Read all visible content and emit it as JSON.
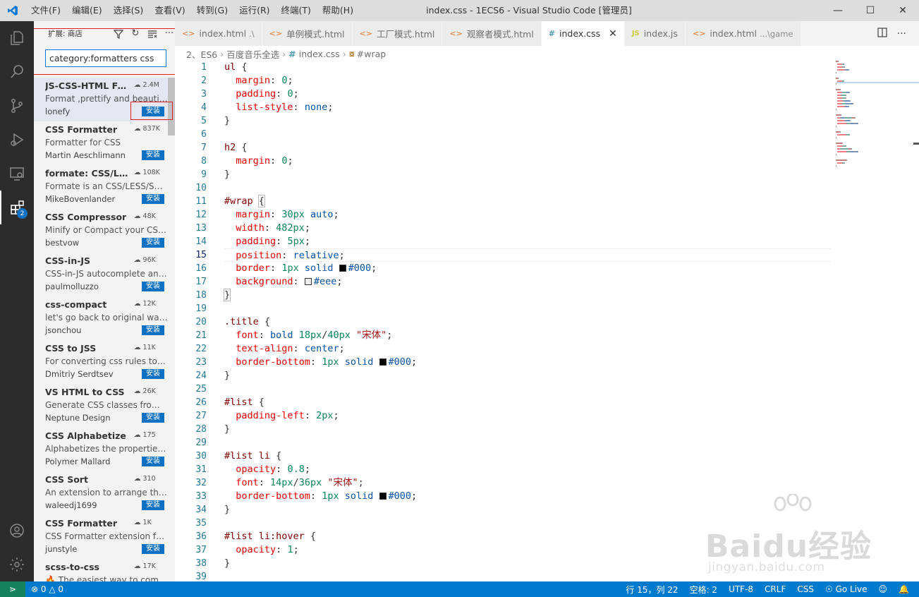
{
  "window": {
    "title": "index.css - 1ECS6 - Visual Studio Code [管理员]",
    "menu": [
      "文件(F)",
      "编辑(E)",
      "选择(S)",
      "查看(V)",
      "转到(G)",
      "运行(R)",
      "终端(T)",
      "帮助(H)"
    ]
  },
  "activity_bar": {
    "extensions_badge": "2"
  },
  "sidebar": {
    "title": "扩展: 商店",
    "search_value": "category:formatters css",
    "install_label": "安装",
    "extensions": [
      {
        "name": "JS-CSS-HTML Fo...",
        "downloads": "2.4M",
        "description": "Format ,prettify and beautify...",
        "author": "lonefy"
      },
      {
        "name": "CSS Formatter",
        "downloads": "837K",
        "description": "Formatter for CSS",
        "author": "Martin Aeschlimann"
      },
      {
        "name": "formate: CSS/LES...",
        "downloads": "108K",
        "description": "Formate is an CSS/LESS/SCS...",
        "author": "MikeBovenlander"
      },
      {
        "name": "CSS Compressor",
        "downloads": "48K",
        "description": "Minify or Compact your CSS...",
        "author": "bestvow"
      },
      {
        "name": "CSS-in-JS",
        "downloads": "96K",
        "description": "CSS-in-JS autocomplete and...",
        "author": "paulmolluzzo"
      },
      {
        "name": "css-compact",
        "downloads": "12K",
        "description": "let's go back to original way...",
        "author": "jsonchou"
      },
      {
        "name": "CSS to JSS",
        "downloads": "11K",
        "description": "For converting css rules to js...",
        "author": "Dmitriy Serdtsev"
      },
      {
        "name": "VS HTML to CSS",
        "downloads": "26K",
        "description": "Generate CSS classes from ...",
        "author": "Neptune Design"
      },
      {
        "name": "CSS Alphabetize",
        "downloads": "175",
        "description": "Alphabetizes the properties ...",
        "author": "Polymer Mallard"
      },
      {
        "name": "CSS Sort",
        "downloads": "310",
        "description": "An extension to arrange the ...",
        "author": "waleedj1699"
      },
      {
        "name": "CSS Formatter",
        "downloads": "1K",
        "description": "CSS Formatter extension for...",
        "author": "junstyle"
      },
      {
        "name": "scss-to-css",
        "downloads": "17K",
        "description": "🔥 The easiest way to compi...",
        "author": ""
      }
    ]
  },
  "tabs": [
    {
      "label": "index.html",
      "sub": ".\\",
      "icon": "<>",
      "kind": "html"
    },
    {
      "label": "单例模式.html",
      "sub": "",
      "icon": "<>",
      "kind": "html"
    },
    {
      "label": "工厂模式.html",
      "sub": "",
      "icon": "<>",
      "kind": "html"
    },
    {
      "label": "观察者模式.html",
      "sub": "",
      "icon": "<>",
      "kind": "html"
    },
    {
      "label": "index.css",
      "sub": "",
      "icon": "#",
      "kind": "css",
      "active": true
    },
    {
      "label": "index.js",
      "sub": "",
      "icon": "JS",
      "kind": "js"
    },
    {
      "label": "index.html",
      "sub": "...\\game",
      "icon": "<>",
      "kind": "html"
    }
  ],
  "breadcrumb": {
    "folder1": "2、ES6",
    "folder2": "百度音乐全选",
    "file": "index.css",
    "symbol": "#wrap"
  },
  "editor": {
    "current_line": 15,
    "lines": [
      [
        [
          "sel",
          "ul "
        ],
        [
          "pun",
          "{"
        ]
      ],
      [
        [
          "",
          "  "
        ],
        [
          "prop",
          "margin"
        ],
        [
          "pun",
          ": "
        ],
        [
          "num",
          "0"
        ],
        [
          "pun",
          ";"
        ]
      ],
      [
        [
          "",
          "  "
        ],
        [
          "prop",
          "padding"
        ],
        [
          "pun",
          ": "
        ],
        [
          "num",
          "0"
        ],
        [
          "pun",
          ";"
        ]
      ],
      [
        [
          "",
          "  "
        ],
        [
          "prop",
          "list-style"
        ],
        [
          "pun",
          ": "
        ],
        [
          "val",
          "none"
        ],
        [
          "pun",
          ";"
        ]
      ],
      [
        [
          "pun",
          "}"
        ]
      ],
      [],
      [
        [
          "sel",
          "h2 "
        ],
        [
          "pun",
          "{"
        ]
      ],
      [
        [
          "",
          "  "
        ],
        [
          "prop",
          "margin"
        ],
        [
          "pun",
          ": "
        ],
        [
          "num",
          "0"
        ],
        [
          "pun",
          ";"
        ]
      ],
      [
        [
          "pun",
          "}"
        ]
      ],
      [],
      [
        [
          "sel",
          "#wrap "
        ],
        [
          "pun",
          "{"
        ]
      ],
      [
        [
          "",
          "  "
        ],
        [
          "prop",
          "margin"
        ],
        [
          "pun",
          ": "
        ],
        [
          "num",
          "30px"
        ],
        [
          "pun",
          " "
        ],
        [
          "val",
          "auto"
        ],
        [
          "pun",
          ";"
        ]
      ],
      [
        [
          "",
          "  "
        ],
        [
          "prop",
          "width"
        ],
        [
          "pun",
          ": "
        ],
        [
          "num",
          "482px"
        ],
        [
          "pun",
          ";"
        ]
      ],
      [
        [
          "",
          "  "
        ],
        [
          "prop",
          "padding"
        ],
        [
          "pun",
          ": "
        ],
        [
          "num",
          "5px"
        ],
        [
          "pun",
          ";"
        ]
      ],
      [
        [
          "",
          "  "
        ],
        [
          "prop",
          "position"
        ],
        [
          "pun",
          ": "
        ],
        [
          "val",
          "relative"
        ],
        [
          "pun",
          ";"
        ]
      ],
      [
        [
          "",
          "  "
        ],
        [
          "prop",
          "border"
        ],
        [
          "pun",
          ": "
        ],
        [
          "num",
          "1px"
        ],
        [
          "pun",
          " "
        ],
        [
          "val",
          "solid"
        ],
        [
          "pun",
          " "
        ],
        [
          "swatch",
          "#000"
        ],
        [
          "val",
          "#000"
        ],
        [
          "pun",
          ";"
        ]
      ],
      [
        [
          "",
          "  "
        ],
        [
          "prop",
          "background"
        ],
        [
          "pun",
          ": "
        ],
        [
          "swatch",
          "#eee"
        ],
        [
          "val",
          "#eee"
        ],
        [
          "pun",
          ";"
        ]
      ],
      [
        [
          "pun",
          "}"
        ]
      ],
      [],
      [
        [
          "sel",
          ".title "
        ],
        [
          "pun",
          "{"
        ]
      ],
      [
        [
          "",
          "  "
        ],
        [
          "prop",
          "font"
        ],
        [
          "pun",
          ": "
        ],
        [
          "val",
          "bold"
        ],
        [
          "pun",
          " "
        ],
        [
          "num",
          "18px"
        ],
        [
          "pun",
          "/"
        ],
        [
          "num",
          "40px"
        ],
        [
          "pun",
          " "
        ],
        [
          "str",
          "\"宋体\""
        ],
        [
          "pun",
          ";"
        ]
      ],
      [
        [
          "",
          "  "
        ],
        [
          "prop",
          "text-align"
        ],
        [
          "pun",
          ": "
        ],
        [
          "val",
          "center"
        ],
        [
          "pun",
          ";"
        ]
      ],
      [
        [
          "",
          "  "
        ],
        [
          "prop",
          "border-bottom"
        ],
        [
          "pun",
          ": "
        ],
        [
          "num",
          "1px"
        ],
        [
          "pun",
          " "
        ],
        [
          "val",
          "solid"
        ],
        [
          "pun",
          " "
        ],
        [
          "swatch",
          "#000"
        ],
        [
          "val",
          "#000"
        ],
        [
          "pun",
          ";"
        ]
      ],
      [
        [
          "pun",
          "}"
        ]
      ],
      [],
      [
        [
          "sel",
          "#list "
        ],
        [
          "pun",
          "{"
        ]
      ],
      [
        [
          "",
          "  "
        ],
        [
          "prop",
          "padding-left"
        ],
        [
          "pun",
          ": "
        ],
        [
          "num",
          "2px"
        ],
        [
          "pun",
          ";"
        ]
      ],
      [
        [
          "pun",
          "}"
        ]
      ],
      [],
      [
        [
          "sel",
          "#list li "
        ],
        [
          "pun",
          "{"
        ]
      ],
      [
        [
          "",
          "  "
        ],
        [
          "prop",
          "opacity"
        ],
        [
          "pun",
          ": "
        ],
        [
          "num",
          "0.8"
        ],
        [
          "pun",
          ";"
        ]
      ],
      [
        [
          "",
          "  "
        ],
        [
          "prop",
          "font"
        ],
        [
          "pun",
          ": "
        ],
        [
          "num",
          "14px"
        ],
        [
          "pun",
          "/"
        ],
        [
          "num",
          "36px"
        ],
        [
          "pun",
          " "
        ],
        [
          "str",
          "\"宋体\""
        ],
        [
          "pun",
          ";"
        ]
      ],
      [
        [
          "",
          "  "
        ],
        [
          "prop",
          "border-bottom"
        ],
        [
          "pun",
          ": "
        ],
        [
          "num",
          "1px"
        ],
        [
          "pun",
          " "
        ],
        [
          "val",
          "solid"
        ],
        [
          "pun",
          " "
        ],
        [
          "swatch",
          "#000"
        ],
        [
          "val",
          "#000"
        ],
        [
          "pun",
          ";"
        ]
      ],
      [
        [
          "pun",
          "}"
        ]
      ],
      [],
      [
        [
          "sel",
          "#list li:hover "
        ],
        [
          "pun",
          "{"
        ]
      ],
      [
        [
          "",
          "  "
        ],
        [
          "prop",
          "opacity"
        ],
        [
          "pun",
          ": "
        ],
        [
          "num",
          "1"
        ],
        [
          "pun",
          ";"
        ]
      ],
      [
        [
          "pun",
          "}"
        ]
      ],
      []
    ]
  },
  "watermark": {
    "brand": "Baidu经验",
    "url": "jingyan.baidu.com"
  },
  "statusbar": {
    "errors": "0",
    "warnings": "0",
    "position": "行 15，列 22",
    "indent": "空格: 2",
    "encoding": "UTF-8",
    "eol": "CRLF",
    "language": "CSS",
    "golive": "Go Live"
  },
  "colors": {
    "accent": "#007acc",
    "install_button": "#0e70c0",
    "highlight_box": "#e02020"
  }
}
